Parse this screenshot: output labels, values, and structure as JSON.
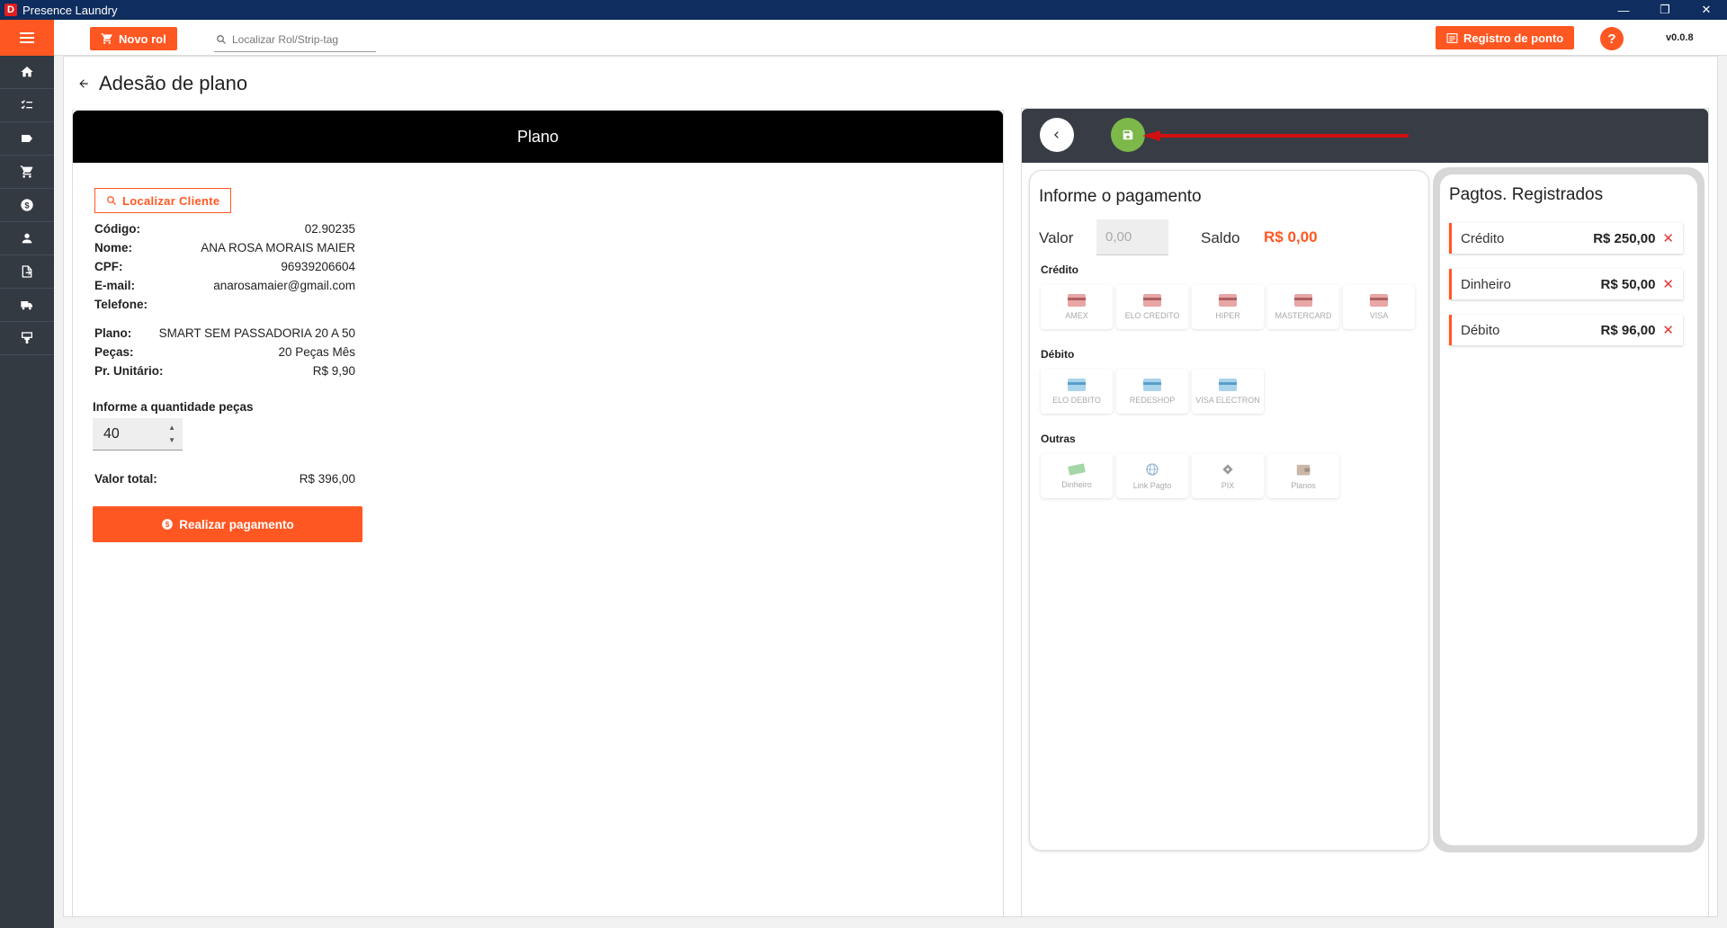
{
  "window": {
    "title": "Presence Laundry",
    "logo_letter": "D"
  },
  "toolbar": {
    "novo_rol": "Novo rol",
    "search_placeholder": "Localizar Rol/Strip-tag",
    "registro": "Registro de ponto",
    "help": "?",
    "version": "v0.0.8"
  },
  "sidebar": {
    "icons": [
      "home-icon",
      "checklist-icon",
      "tag-icon",
      "cart-icon",
      "money-icon",
      "user-icon",
      "export-icon",
      "truck-icon",
      "plant-icon"
    ]
  },
  "page": {
    "title": "Adesão de plano"
  },
  "plano": {
    "header": "Plano",
    "localizar_cliente": "Localizar Cliente",
    "cliente": [
      {
        "label": "Código:",
        "value": "02.90235"
      },
      {
        "label": "Nome:",
        "value": "ANA ROSA MORAIS MAIER"
      },
      {
        "label": "CPF:",
        "value": "96939206604"
      },
      {
        "label": "E-mail:",
        "value": "anarosamaier@gmail.com"
      },
      {
        "label": "Telefone:",
        "value": ""
      }
    ],
    "plano_info": [
      {
        "label": "Plano:",
        "value": "SMART SEM PASSADORIA 20 A 50"
      },
      {
        "label": "Peças:",
        "value": "20 Peças Mês"
      },
      {
        "label": "Pr. Unitário:",
        "value": "R$ 9,90"
      }
    ],
    "quantidade_label": "Informe a quantidade peças",
    "quantidade_value": "40",
    "valor_total_label": "Valor total:",
    "valor_total_value": "R$ 396,00",
    "realizar_pagamento": "Realizar pagamento"
  },
  "pagamento": {
    "title": "Informe o pagamento",
    "valor_label": "Valor",
    "valor_placeholder": "0,00",
    "saldo_label": "Saldo",
    "saldo_value": "R$ 0,00",
    "credito_label": "Crédito",
    "credito": [
      "AMEX",
      "ELO CREDITO",
      "HIPER",
      "MASTERCARD",
      "VISA"
    ],
    "debito_label": "Débito",
    "debito": [
      "ELO DEBITO",
      "REDESHOP",
      "VISA ELECTRON"
    ],
    "outras_label": "Outras",
    "outras": [
      "Dinheiro",
      "Link Pagto",
      "PIX",
      "Planos"
    ]
  },
  "registrados": {
    "title": "Pagtos. Registrados",
    "items": [
      {
        "name": "Crédito",
        "value": "R$ 250,00"
      },
      {
        "name": "Dinheiro",
        "value": "R$ 50,00"
      },
      {
        "name": "Débito",
        "value": "R$ 96,00"
      }
    ]
  },
  "colors": {
    "accent": "#ff5722",
    "sidebar": "#333a42",
    "titlebar": "#0f2d5e",
    "save": "#7cb84a"
  }
}
